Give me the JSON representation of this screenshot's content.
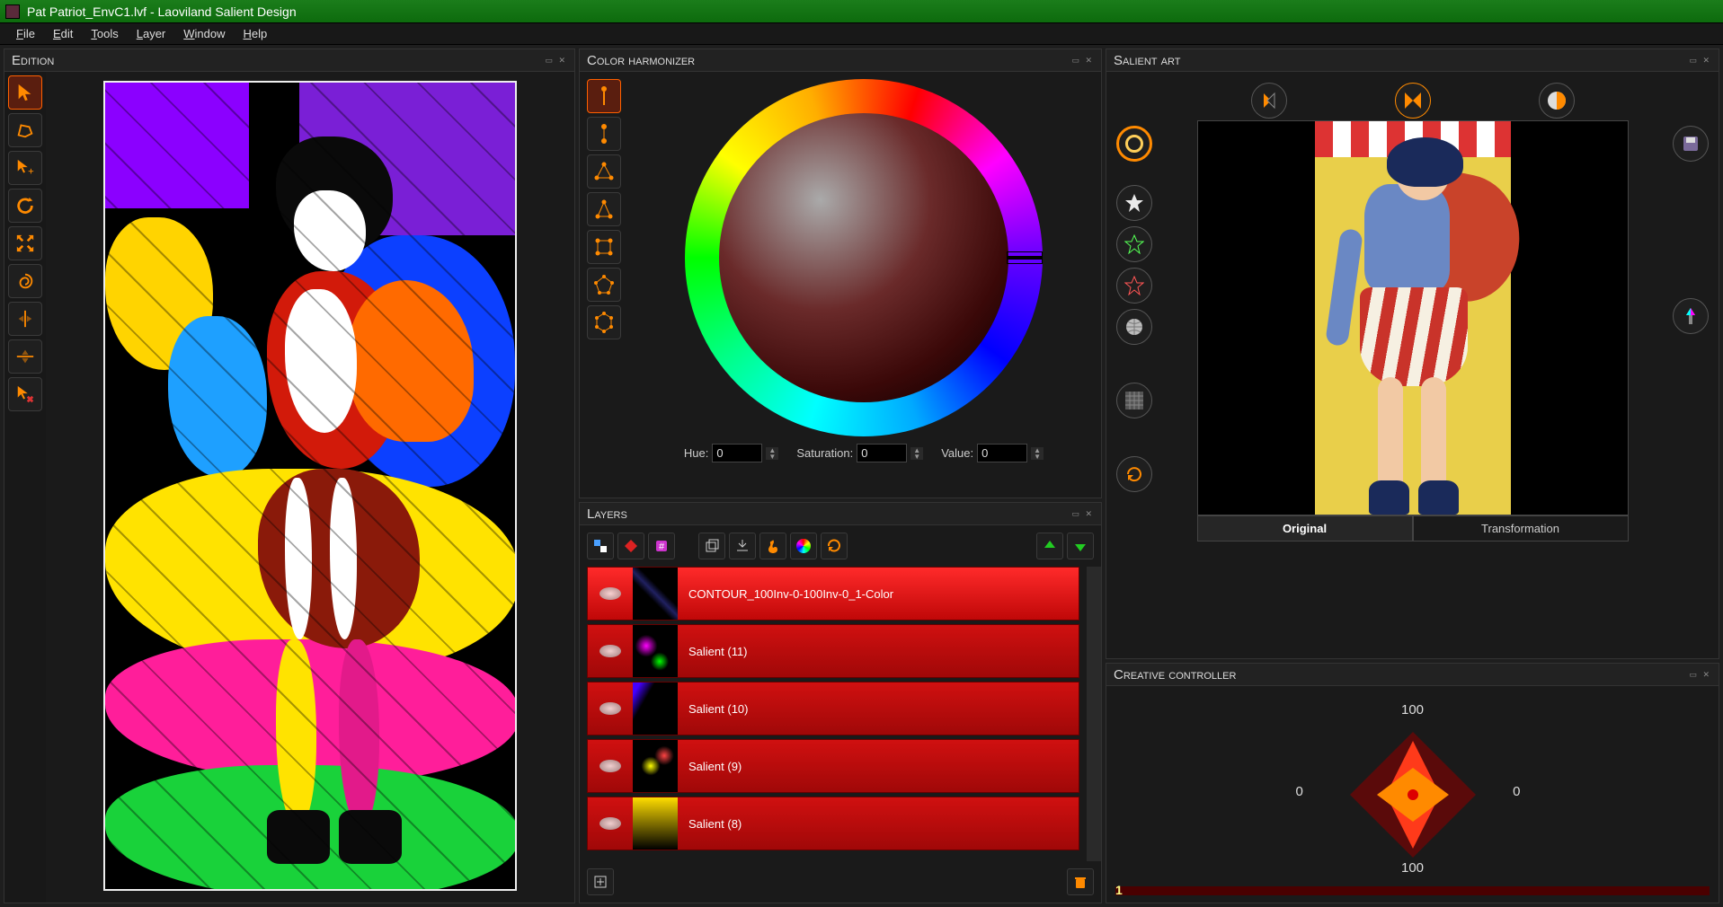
{
  "titlebar": "Pat Patriot_EnvC1.lvf - Laoviland Salient Design",
  "menu": {
    "file": "File",
    "edit": "Edit",
    "tools": "Tools",
    "layer": "Layer",
    "window": "Window",
    "help": "Help"
  },
  "panels": {
    "edition": "Edition",
    "harmonizer": "Color harmonizer",
    "layers": "Layers",
    "salient": "Salient art",
    "creative": "Creative controller"
  },
  "hsv": {
    "hue_label": "Hue:",
    "hue": "0",
    "sat_label": "Saturation:",
    "sat": "0",
    "val_label": "Value:",
    "val": "0"
  },
  "layers_items": [
    {
      "name": "CONTOUR_100Inv-0-100Inv-0_1-Color",
      "selected": true
    },
    {
      "name": "Salient (11)"
    },
    {
      "name": "Salient (10)"
    },
    {
      "name": "Salient (9)"
    },
    {
      "name": "Salient (8)"
    }
  ],
  "salient_tabs": {
    "original": "Original",
    "transformation": "Transformation"
  },
  "creative": {
    "top": "100",
    "right": "0",
    "bottom": "100",
    "left": "0",
    "slider": "1"
  },
  "colors": {
    "accent": "#ff8a00"
  }
}
